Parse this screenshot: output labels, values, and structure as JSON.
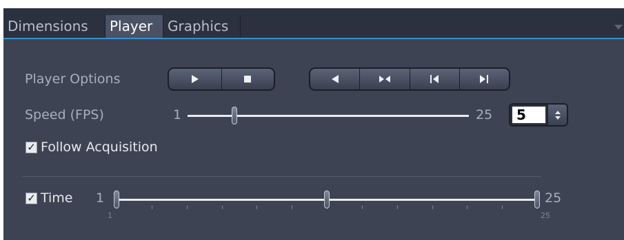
{
  "tabs": [
    {
      "label": "Dimensions",
      "active": false
    },
    {
      "label": "Player",
      "active": true
    },
    {
      "label": "Graphics",
      "active": false
    }
  ],
  "player_options": {
    "label": "Player Options",
    "group1": [
      "play-icon",
      "stop-icon"
    ],
    "group2": [
      "step-back-icon",
      "bounce-icon",
      "skip-to-start-icon",
      "skip-to-end-icon"
    ]
  },
  "speed": {
    "label": "Speed (FPS)",
    "min": "1",
    "max": "25",
    "value": "5",
    "slider_value": 5
  },
  "follow_acquisition": {
    "label": "Follow Acquisition",
    "checked": true
  },
  "time": {
    "label": "Time",
    "min_label": "1",
    "max_label": "25",
    "scale_min": "1",
    "scale_max": "25",
    "range_start": 1,
    "range_end": 25,
    "current": 13,
    "checked": true
  },
  "colors": {
    "panel": "#3d4352",
    "tab_bar": "#2c3140",
    "accent": "#3a8fd0"
  }
}
